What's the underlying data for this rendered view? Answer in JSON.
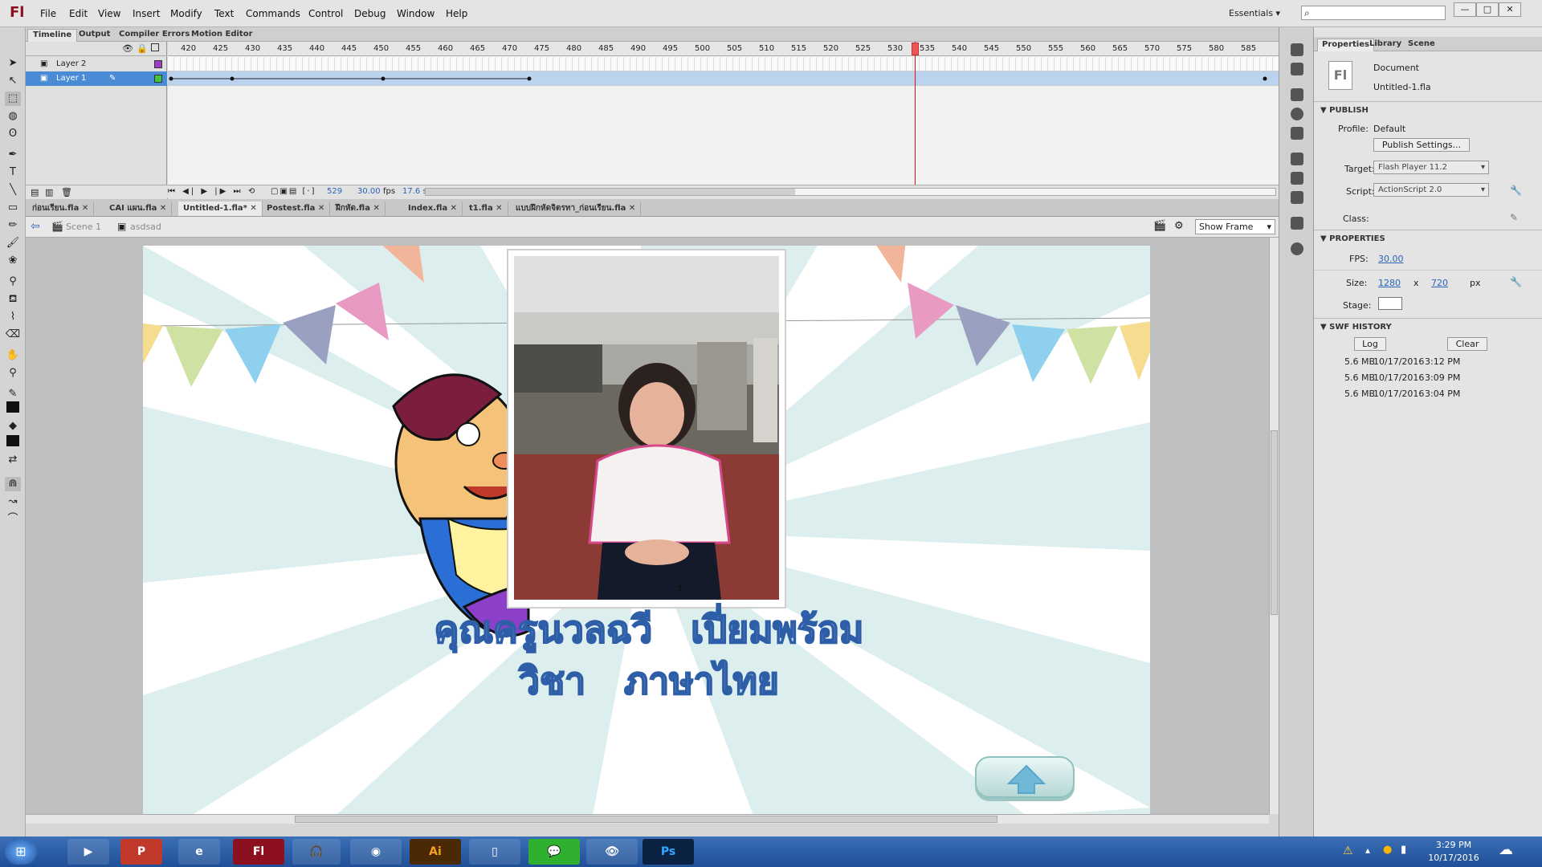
{
  "app": {
    "logo": "Fl",
    "menu": [
      "File",
      "Edit",
      "View",
      "Insert",
      "Modify",
      "Text",
      "Commands",
      "Control",
      "Debug",
      "Window",
      "Help"
    ],
    "workspace": "Essentials",
    "window_buttons": [
      "—",
      "□",
      "✕"
    ]
  },
  "timeline": {
    "tabs": [
      "Timeline",
      "Output",
      "Compiler Errors",
      "Motion Editor"
    ],
    "layers": [
      "Layer 2",
      "Layer 1"
    ],
    "ruler": [
      "420",
      "425",
      "430",
      "435",
      "440",
      "445",
      "450",
      "455",
      "460",
      "465",
      "470",
      "475",
      "480",
      "485",
      "490",
      "495",
      "500",
      "505",
      "510",
      "515",
      "520",
      "525",
      "530",
      "535",
      "540",
      "545",
      "550",
      "555",
      "560",
      "565",
      "570",
      "575",
      "580",
      "585"
    ],
    "current_frame": "529",
    "fps": "30.00",
    "fps_unit": "fps",
    "elapsed": "17.6 s"
  },
  "doc_tabs": [
    "ก่อนเรียน.fla",
    "CAI แผน.fla",
    "Untitled-1.fla*",
    "Postest.fla",
    "ฝึกหัด.fla",
    "Index.fla",
    "t1.fla",
    "แบบฝึกหัดจิตรทา_ก่อนเรียน.fla"
  ],
  "editbar": {
    "scene": "Scene 1",
    "symbol": "asdsad",
    "view": "Show Frame"
  },
  "stage": {
    "line1": "คุณครูนวลฉวี   เปี่ยมพร้อม",
    "line2": "วิชา   ภาษาไทย"
  },
  "properties": {
    "tabs": [
      "Properties",
      "Library",
      "Scene"
    ],
    "doc_type": "Document",
    "doc_name": "Untitled-1.fla",
    "publish_header": "PUBLISH",
    "profile_label": "Profile:",
    "profile_value": "Default",
    "publish_settings": "Publish Settings...",
    "target_label": "Target:",
    "target_value": "Flash Player 11.2",
    "script_label": "Script:",
    "script_value": "ActionScript 2.0",
    "class_label": "Class:",
    "props_header": "PROPERTIES",
    "fps_label": "FPS:",
    "fps_value": "30.00",
    "size_label": "Size:",
    "width": "1280",
    "x": "x",
    "height": "720",
    "unit": "px",
    "stage_label": "Stage:",
    "history_header": "SWF HISTORY",
    "log": "Log",
    "clear": "Clear",
    "history": [
      {
        "size": "5.6 MB",
        "date": "10/17/2016",
        "time": "3:12 PM"
      },
      {
        "size": "5.6 MB",
        "date": "10/17/2016",
        "time": "3:09 PM"
      },
      {
        "size": "5.6 MB",
        "date": "10/17/2016",
        "time": "3:04 PM"
      }
    ]
  },
  "taskbar": {
    "apps": [
      "Fl",
      "Ai",
      "Ps"
    ],
    "time": "3:29 PM",
    "date": "10/17/2016"
  }
}
